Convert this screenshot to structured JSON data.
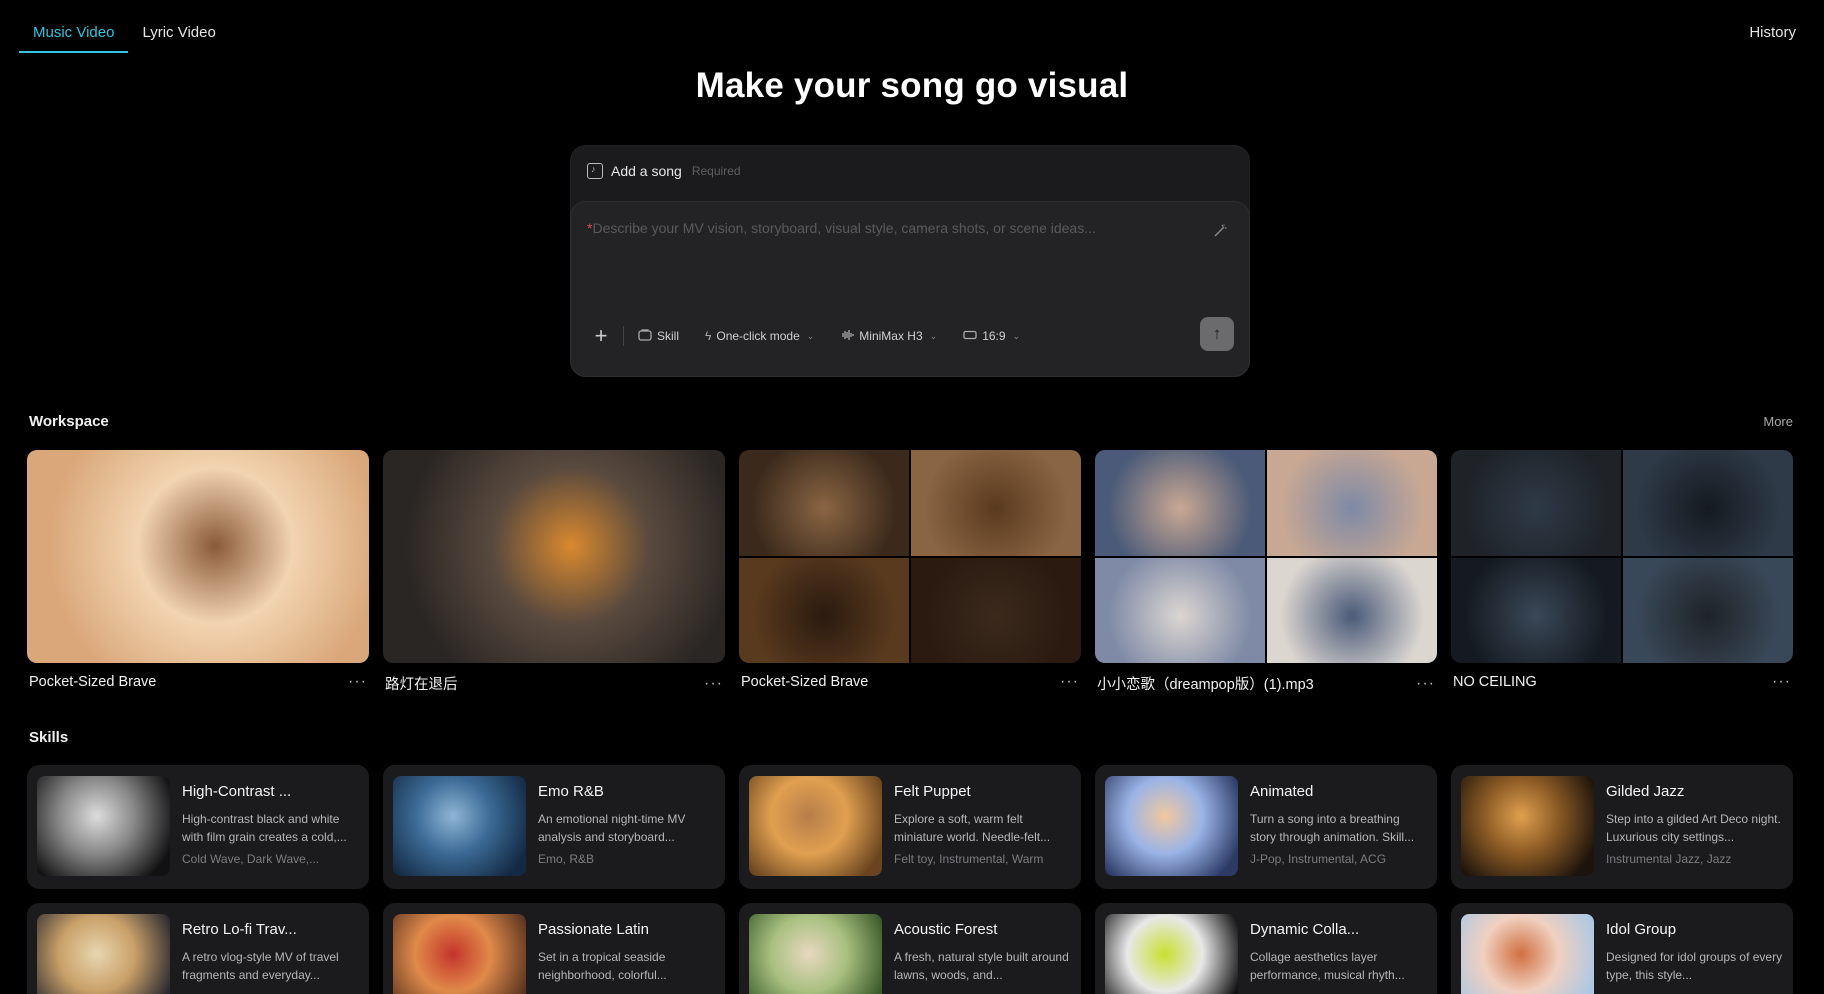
{
  "tabs": [
    {
      "label": "Music Video",
      "active": true
    },
    {
      "label": "Lyric Video",
      "active": false
    }
  ],
  "history_label": "History",
  "title": "Make your song go visual",
  "composer": {
    "add_song": "Add a song",
    "required": "Required",
    "placeholder_star": "*",
    "placeholder": "Describe your MV vision, storyboard, visual style, camera shots, or scene ideas...",
    "tools": {
      "skill": "Skill",
      "mode": "One-click mode",
      "model": "MiniMax H3",
      "ratio": "16:9"
    }
  },
  "workspace": {
    "title": "Workspace",
    "more": "More",
    "items": [
      {
        "name": "Pocket-Sized Brave",
        "palette": [
          "#d9a77a",
          "#8a5a3a",
          "#f2d4b0",
          "#6bb3c4"
        ]
      },
      {
        "name": "路灯在退后",
        "palette": [
          "#2a2624",
          "#d9892e",
          "#5a4a3e",
          "#c9651e"
        ]
      },
      {
        "name": "Pocket-Sized Brave",
        "palette": [
          "#3b2a1c",
          "#8a6544",
          "#5a3a1e",
          "#2a1a10"
        ]
      },
      {
        "name": "小小恋歌（dreampop版）(1).mp3",
        "palette": [
          "#4a5a78",
          "#c9a893",
          "#7e8aa6",
          "#dcd6d1"
        ]
      },
      {
        "name": "NO CEILING",
        "palette": [
          "#1f2328",
          "#2e3a48",
          "#151a20",
          "#394858"
        ]
      }
    ]
  },
  "skills": {
    "title": "Skills",
    "items": [
      {
        "name": "High-Contrast ...",
        "desc": "High-contrast black and white with film grain creates a cold,...",
        "tags": "Cold Wave, Dark Wave,...",
        "palette": [
          "#111",
          "#888",
          "#ddd"
        ]
      },
      {
        "name": "Emo R&B",
        "desc": "An emotional night-time MV analysis and storyboard...",
        "tags": "Emo, R&B",
        "palette": [
          "#142a44",
          "#3b6a95",
          "#8fb6d6"
        ]
      },
      {
        "name": "Felt Puppet",
        "desc": "Explore a soft, warm felt miniature world. Needle-felt...",
        "tags": "Felt toy, Instrumental, Warm",
        "palette": [
          "#6a4420",
          "#e0a050",
          "#b77d4a"
        ]
      },
      {
        "name": "Animated",
        "desc": "Turn a song into a breathing story through animation. Skill...",
        "tags": "J-Pop, Instrumental, ACG",
        "palette": [
          "#2d3a66",
          "#9ab4e6",
          "#f0c8a0"
        ]
      },
      {
        "name": "Gilded Jazz",
        "desc": "Step into a gilded Art Deco night. Luxurious city settings...",
        "tags": "Instrumental Jazz, Jazz",
        "palette": [
          "#1c130c",
          "#8a5a24",
          "#e0a050"
        ]
      },
      {
        "name": "Retro Lo-fi Trav...",
        "desc": "A retro vlog-style MV of travel fragments and everyday...",
        "tags": "",
        "palette": [
          "#2a2a30",
          "#c9a068",
          "#e8d6b0"
        ]
      },
      {
        "name": "Passionate Latin",
        "desc": "Set in a tropical seaside neighborhood, colorful...",
        "tags": "",
        "palette": [
          "#5a3420",
          "#e08a4a",
          "#c4342a"
        ]
      },
      {
        "name": "Acoustic Forest",
        "desc": "A fresh, natural style built around lawns, woods, and...",
        "tags": "",
        "palette": [
          "#3a5a2a",
          "#a8c080",
          "#e8d8c0"
        ]
      },
      {
        "name": "Dynamic Colla...",
        "desc": "Collage aesthetics layer performance, musical rhyth...",
        "tags": "",
        "palette": [
          "#111",
          "#e8e8e8",
          "#c8e030"
        ]
      },
      {
        "name": "Idol Group",
        "desc": "Designed for idol groups of every type, this style...",
        "tags": "",
        "palette": [
          "#a8c8e6",
          "#f0d0c0",
          "#d07040"
        ]
      }
    ]
  }
}
